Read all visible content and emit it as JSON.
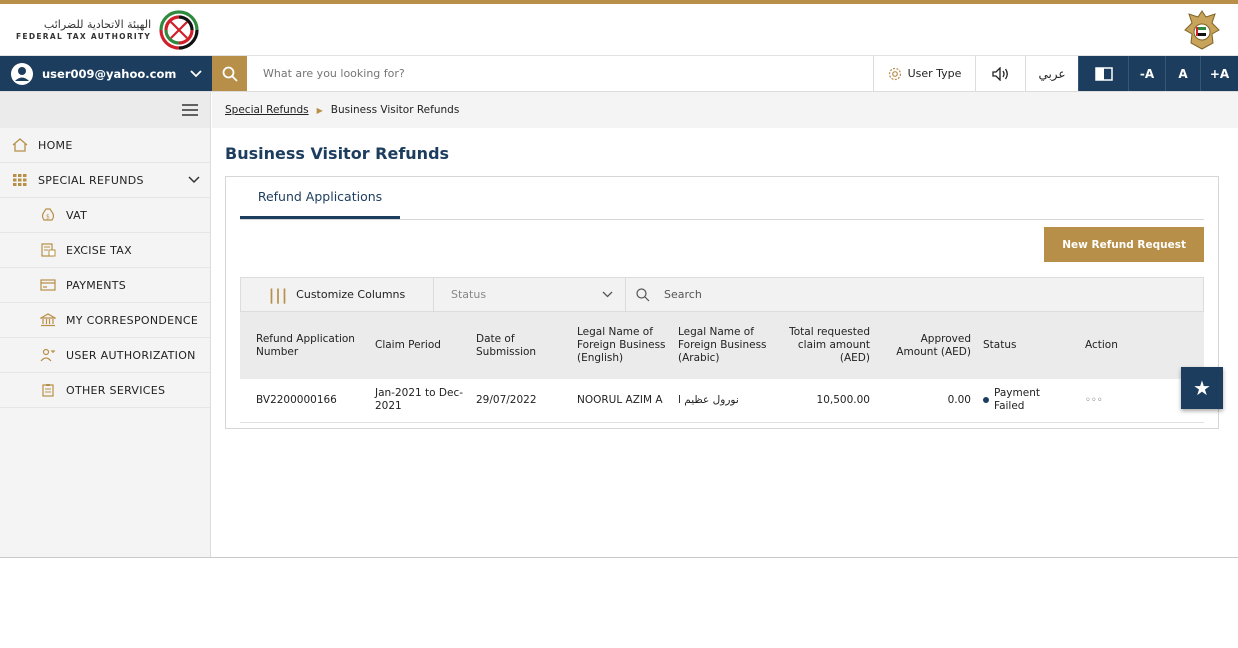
{
  "header": {
    "logo_arabic": "الهيئة الاتحادية للضرائب",
    "logo_english": "FEDERAL TAX AUTHORITY",
    "logo_icon": "fta-logo-icon",
    "emblem_icon": "uae-emblem-icon"
  },
  "toolbar": {
    "user_email": "user009@yahoo.com",
    "search_placeholder": "What are you looking for?",
    "user_type_label": "User Type",
    "arabic_label": "عربي",
    "font_decrease": "-A",
    "font_normal": "A",
    "font_increase": "+A"
  },
  "sidebar": {
    "items": [
      {
        "label": "HOME",
        "icon": "home-icon"
      },
      {
        "label": "SPECIAL REFUNDS",
        "icon": "grid-icon"
      },
      {
        "label": "VAT",
        "icon": "money-bag-icon"
      },
      {
        "label": "EXCISE TAX",
        "icon": "excise-document-icon"
      },
      {
        "label": "PAYMENTS",
        "icon": "card-icon"
      },
      {
        "label": "MY CORRESPONDENCE",
        "icon": "bank-icon"
      },
      {
        "label": "USER AUTHORIZATION",
        "icon": "user-key-icon"
      },
      {
        "label": "OTHER SERVICES",
        "icon": "clipboard-icon"
      }
    ]
  },
  "breadcrumb": {
    "parent": "Special Refunds",
    "current": "Business Visitor Refunds"
  },
  "main": {
    "title": "Business Visitor Refunds",
    "tab_label": "Refund Applications",
    "new_button": "New Refund Request",
    "customize_label": "Customize Columns",
    "status_placeholder": "Status",
    "search_placeholder": "Search"
  },
  "table": {
    "headers": [
      "Refund Application Number",
      "Claim Period",
      "Date of Submission",
      "Legal Name of Foreign Business (English)",
      "Legal Name of Foreign Business (Arabic)",
      "Total requested claim amount (AED)",
      "Approved Amount (AED)",
      "Status",
      "Action"
    ],
    "rows": [
      {
        "number": "BV2200000166",
        "period": "Jan-2021 to Dec-2021",
        "date": "29/07/2022",
        "name_en": "NOORUL AZIM A",
        "name_ar": "نورول عظيم ا",
        "total": "10,500.00",
        "approved": "0.00",
        "status": "Payment Failed",
        "action": "◦◦◦"
      }
    ]
  },
  "colors": {
    "primary": "#1c3d5e",
    "accent": "#b78f49"
  }
}
